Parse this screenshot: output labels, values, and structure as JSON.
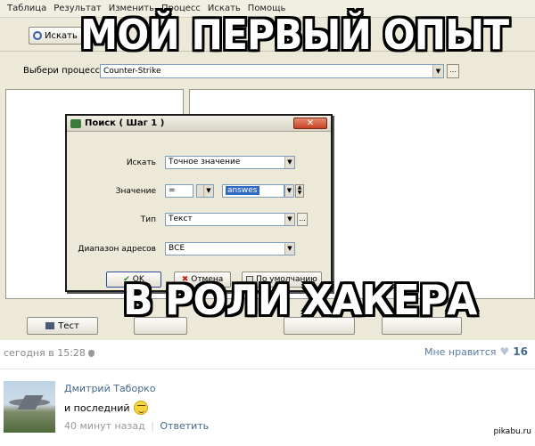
{
  "menu": [
    "Таблица",
    "Результат",
    "Изменить",
    "Процесс",
    "Искать",
    "Помощь"
  ],
  "toolbar": {
    "search_label": "Искать"
  },
  "process": {
    "label": "Выбери процесс",
    "value": "Counter-Strike",
    "more": "..."
  },
  "bottom_bar": {
    "test_label": "Тест"
  },
  "dialog": {
    "title": "Поиск ( Шаг 1 )",
    "close": "✕",
    "search_label": "Искать",
    "search_value": "Точное значение",
    "value_label": "Значение",
    "operator": "=",
    "value": "answes",
    "type_label": "Тип",
    "type_value": "Текст",
    "range_label": "Диапазон адресов",
    "range_value": "ВСЕ",
    "ok_label": "OK",
    "cancel_label": "Отмена",
    "default_label": "По умолчанию"
  },
  "meme": {
    "top": "МОЙ ПЕРВЫЙ ОПЫТ",
    "bottom": "В РОЛИ ХАКЕРА"
  },
  "post": {
    "time": "сегодня в 15:28",
    "like_label": "Мне нравится",
    "like_count": "16"
  },
  "comment": {
    "author": "Дмитрий Таборко",
    "text": "и последний",
    "time": "40 минут назад",
    "separator": "|",
    "reply": "Ответить"
  },
  "watermark": "pikabu.ru"
}
